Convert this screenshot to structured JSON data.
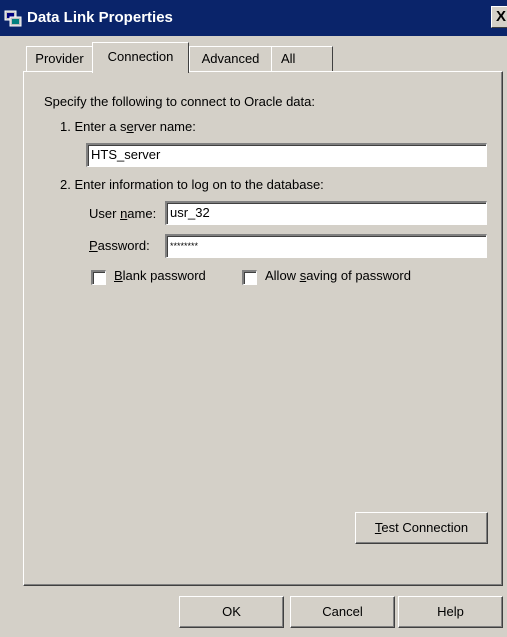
{
  "window": {
    "title": "Data Link Properties",
    "close_label": "X",
    "icon": "data-link-icon"
  },
  "tabs": [
    {
      "label": "Provider",
      "active": false
    },
    {
      "label": "Connection",
      "active": true
    },
    {
      "label": "Advanced",
      "active": false
    },
    {
      "label": "All",
      "active": false
    }
  ],
  "connection": {
    "intro": "Specify the following to connect to Oracle data:",
    "step1": {
      "prefix": "1. Enter a s",
      "mnemonic": "e",
      "suffix": "rver name:"
    },
    "server_name": "HTS_server",
    "step2": "2. Enter information to log on to the database:",
    "user_label": {
      "prefix": "User ",
      "mnemonic": "n",
      "suffix": "ame:"
    },
    "user_name": "usr_32",
    "password_label": {
      "prefix": "",
      "mnemonic": "P",
      "suffix": "assword:"
    },
    "password_mask": "********",
    "blank_password": {
      "prefix": "",
      "mnemonic": "B",
      "suffix": "lank password",
      "checked": false
    },
    "allow_saving": {
      "prefix": "Allow ",
      "mnemonic": "s",
      "suffix": "aving of password",
      "checked": false
    },
    "test_button": {
      "prefix": "",
      "mnemonic": "T",
      "suffix": "est Connection"
    }
  },
  "footer": {
    "ok": "OK",
    "cancel": "Cancel",
    "help": "Help"
  }
}
